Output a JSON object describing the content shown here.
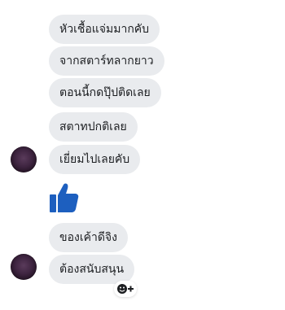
{
  "messages": [
    {
      "text": "หัวเชื้อแจ่มมากคับ"
    },
    {
      "text": "จากสตาร์ทลากยาว"
    },
    {
      "text": "ตอนนี้กดปุ๊ปติดเลย"
    },
    {
      "text": "สตาทปกติเลย"
    },
    {
      "text": "เยี่ยมไปเลยคับ"
    },
    {
      "text": "ของเค้าดีจิง"
    },
    {
      "text": "ต้องสนับสนุน"
    }
  ],
  "icons": {
    "thumb": "thumbs-up-icon",
    "reaction": "add-reaction-icon"
  },
  "colors": {
    "bubble": "#e9ebee",
    "like": "#1d5fbf"
  }
}
